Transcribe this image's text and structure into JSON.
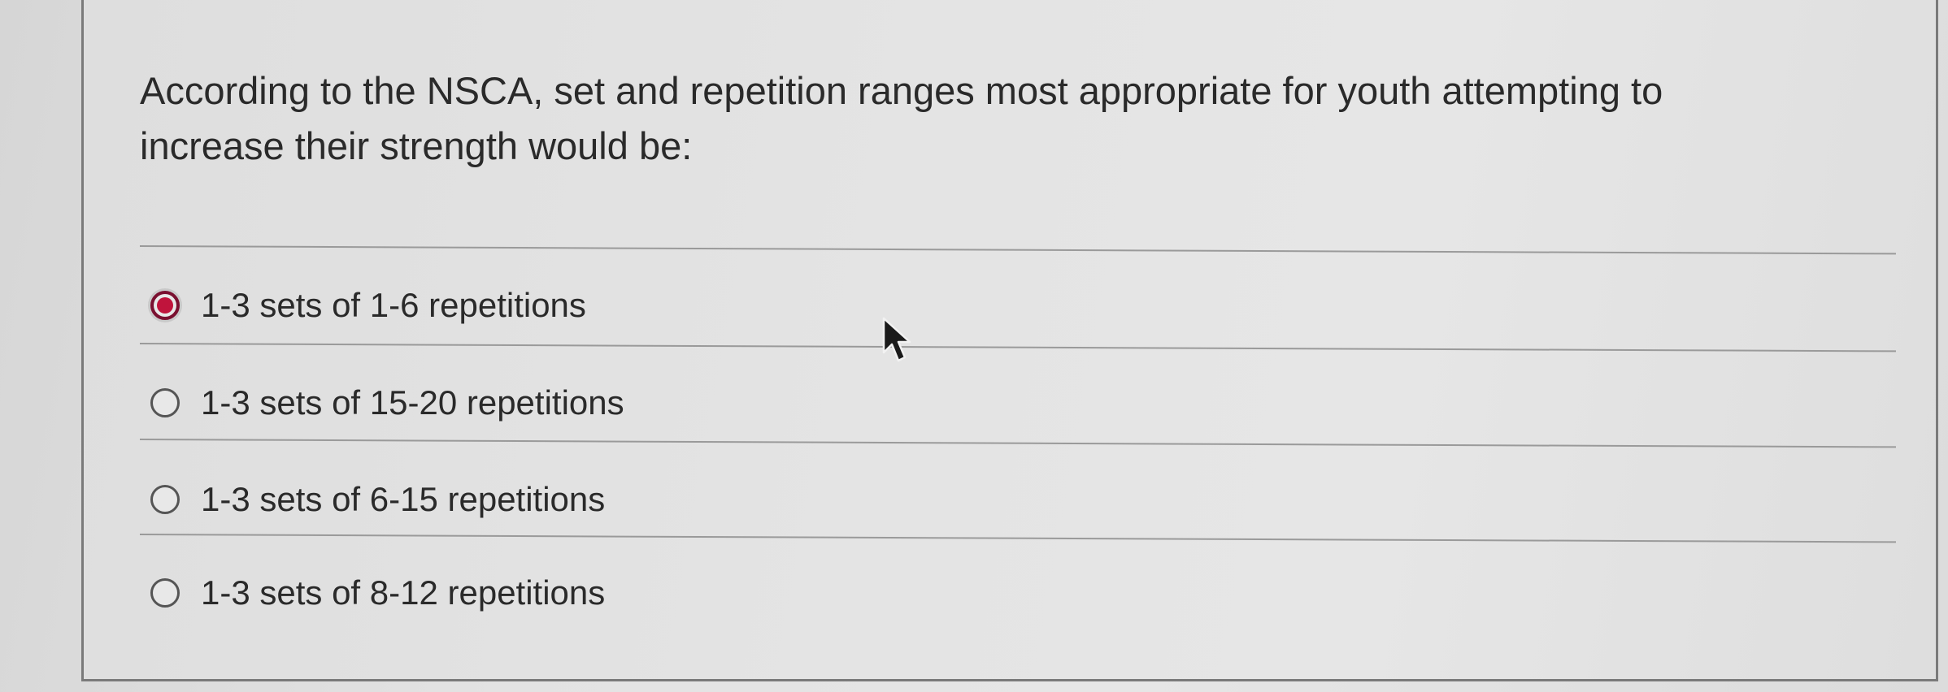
{
  "question": {
    "line1": "According to the NSCA, set and repetition ranges most appropriate for youth attempting to",
    "line2": "increase their strength would be:"
  },
  "answers": [
    {
      "label": "1-3 sets of 1-6 repetitions",
      "selected": true
    },
    {
      "label": "1-3 sets of 15-20 repetitions",
      "selected": false
    },
    {
      "label": "1-3 sets of 6-15 repetitions",
      "selected": false
    },
    {
      "label": "1-3 sets of 8-12 repetitions",
      "selected": false
    }
  ],
  "colors": {
    "selected_radio": "#c0143c",
    "text": "#2a2a2a",
    "divider": "#9a9a9a"
  },
  "icons": {
    "cursor": "mouse-pointer-icon",
    "radio": "radio-button-icon"
  }
}
